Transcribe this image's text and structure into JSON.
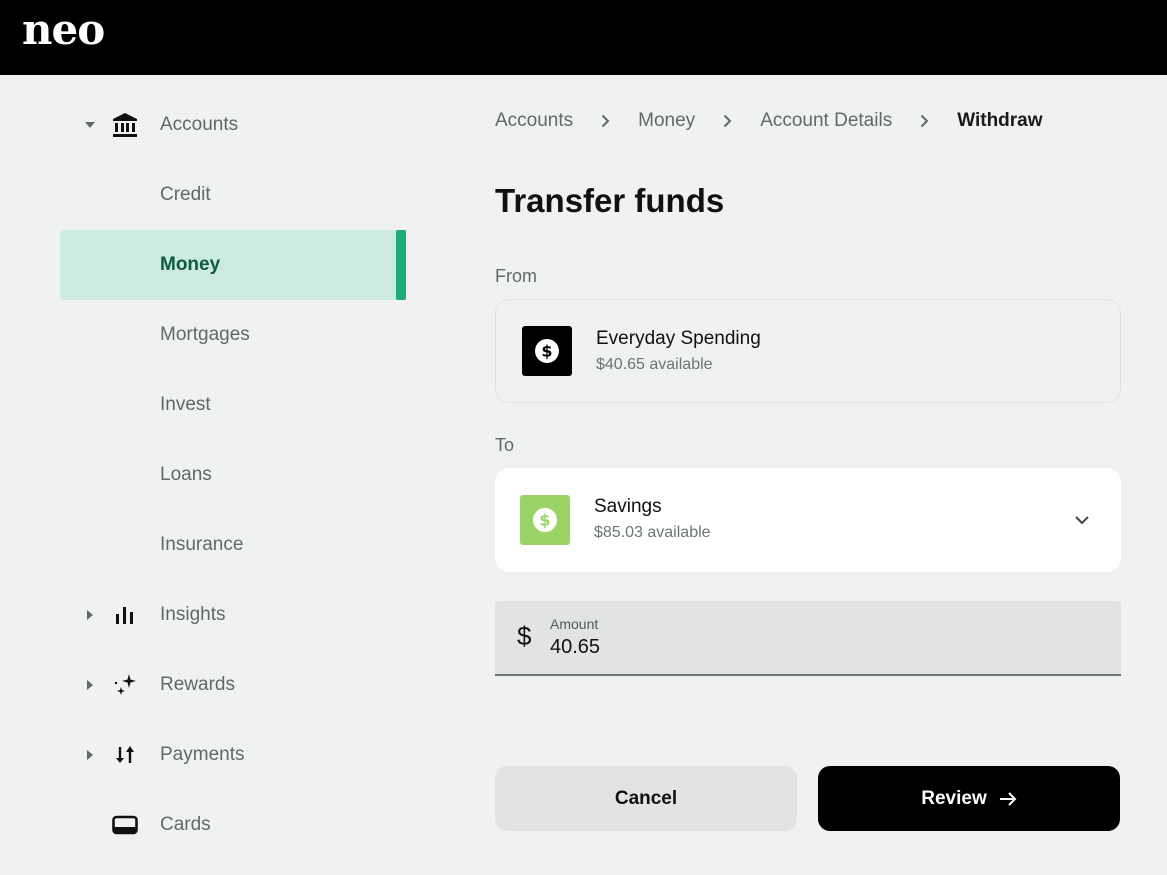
{
  "app": {
    "logo": "neo"
  },
  "sidebar": {
    "items": [
      {
        "label": "Accounts",
        "icon": "bank-icon",
        "expandable": true,
        "expanded": true
      },
      {
        "label": "Credit"
      },
      {
        "label": "Money",
        "active": true
      },
      {
        "label": "Mortgages"
      },
      {
        "label": "Invest"
      },
      {
        "label": "Loans"
      },
      {
        "label": "Insurance"
      },
      {
        "label": "Insights",
        "icon": "bar-chart-icon",
        "expandable": true
      },
      {
        "label": "Rewards",
        "icon": "sparkle-icon",
        "expandable": true
      },
      {
        "label": "Payments",
        "icon": "transfer-arrows-icon",
        "expandable": true
      },
      {
        "label": "Cards",
        "icon": "card-icon"
      }
    ]
  },
  "breadcrumb": [
    "Accounts",
    "Money",
    "Account Details",
    "Withdraw"
  ],
  "main": {
    "title": "Transfer funds",
    "from": {
      "label": "From",
      "account_name": "Everyday Spending",
      "available": "$40.65 available",
      "icon": "dollar-coin-icon",
      "icon_bg": "#000000"
    },
    "to": {
      "label": "To",
      "account_name": "Savings",
      "available": "$85.03 available",
      "icon": "dollar-coin-icon",
      "icon_bg": "#9bd466"
    },
    "amount": {
      "currency_symbol": "$",
      "label": "Amount",
      "value": "40.65"
    },
    "buttons": {
      "cancel": "Cancel",
      "review": "Review"
    }
  },
  "colors": {
    "accent": "#1faa76",
    "active_bg": "#cdeae0",
    "page_bg": "#f0f2f1"
  }
}
